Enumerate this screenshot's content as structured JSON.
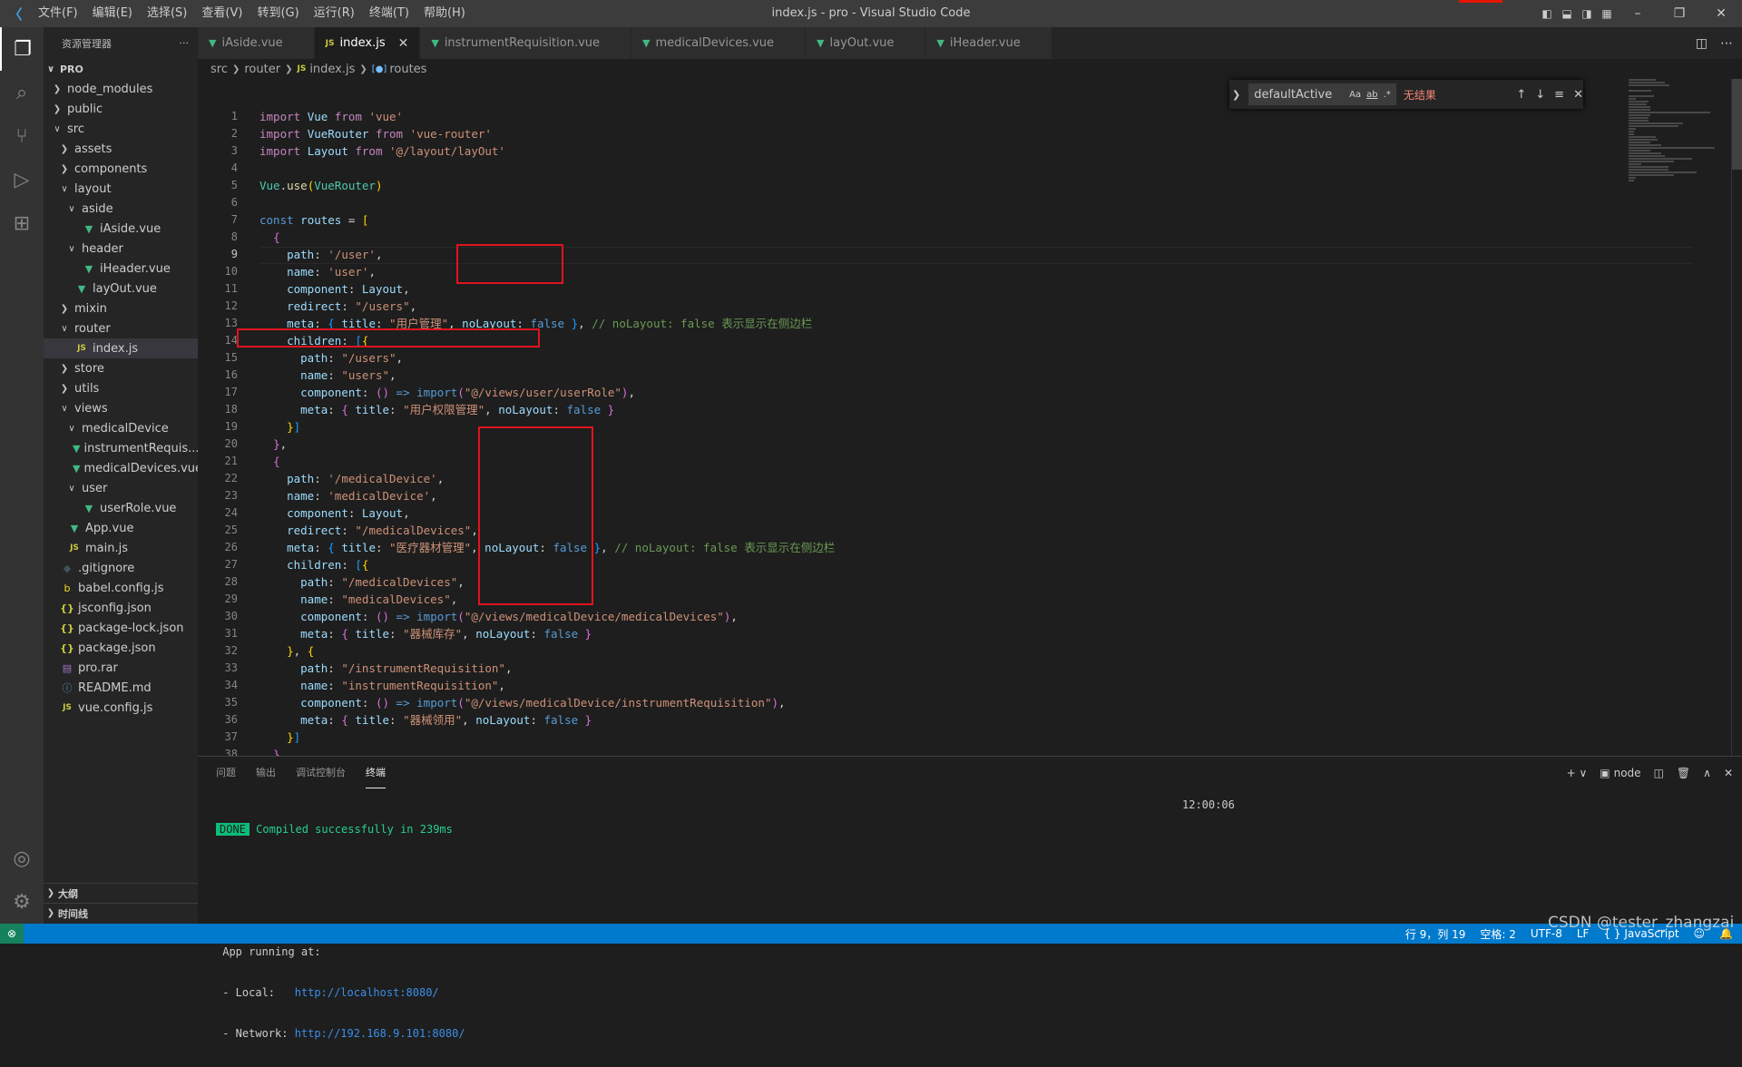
{
  "window": {
    "title": "index.js - pro - Visual Studio Code",
    "menu": [
      "文件(F)",
      "编辑(E)",
      "选择(S)",
      "查看(V)",
      "转到(G)",
      "运行(R)",
      "终端(T)",
      "帮助(H)"
    ]
  },
  "sidebar": {
    "title": "资源管理器",
    "more": "···",
    "root": "PRO",
    "tree": [
      {
        "label": "node_modules",
        "depth": 0,
        "type": "folder",
        "open": false
      },
      {
        "label": "public",
        "depth": 0,
        "type": "folder",
        "open": false
      },
      {
        "label": "src",
        "depth": 0,
        "type": "folder",
        "open": true
      },
      {
        "label": "assets",
        "depth": 1,
        "type": "folder",
        "open": false
      },
      {
        "label": "components",
        "depth": 1,
        "type": "folder",
        "open": false
      },
      {
        "label": "layout",
        "depth": 1,
        "type": "folder",
        "open": true
      },
      {
        "label": "aside",
        "depth": 2,
        "type": "folder",
        "open": true
      },
      {
        "label": "iAside.vue",
        "depth": 3,
        "type": "vue"
      },
      {
        "label": "header",
        "depth": 2,
        "type": "folder",
        "open": true
      },
      {
        "label": "iHeader.vue",
        "depth": 3,
        "type": "vue"
      },
      {
        "label": "layOut.vue",
        "depth": 2,
        "type": "vue"
      },
      {
        "label": "mixin",
        "depth": 1,
        "type": "folder",
        "open": false
      },
      {
        "label": "router",
        "depth": 1,
        "type": "folder",
        "open": true
      },
      {
        "label": "index.js",
        "depth": 2,
        "type": "js",
        "selected": true
      },
      {
        "label": "store",
        "depth": 1,
        "type": "folder",
        "open": false
      },
      {
        "label": "utils",
        "depth": 1,
        "type": "folder",
        "open": false
      },
      {
        "label": "views",
        "depth": 1,
        "type": "folder",
        "open": true
      },
      {
        "label": "medicalDevice",
        "depth": 2,
        "type": "folder",
        "open": true
      },
      {
        "label": "instrumentRequis...",
        "depth": 3,
        "type": "vue"
      },
      {
        "label": "medicalDevices.vue",
        "depth": 3,
        "type": "vue"
      },
      {
        "label": "user",
        "depth": 2,
        "type": "folder",
        "open": true
      },
      {
        "label": "userRole.vue",
        "depth": 3,
        "type": "vue"
      },
      {
        "label": "App.vue",
        "depth": 1,
        "type": "vue"
      },
      {
        "label": "main.js",
        "depth": 1,
        "type": "js"
      },
      {
        "label": ".gitignore",
        "depth": 0,
        "type": "git"
      },
      {
        "label": "babel.config.js",
        "depth": 0,
        "type": "babel"
      },
      {
        "label": "jsconfig.json",
        "depth": 0,
        "type": "json"
      },
      {
        "label": "package-lock.json",
        "depth": 0,
        "type": "json"
      },
      {
        "label": "package.json",
        "depth": 0,
        "type": "json"
      },
      {
        "label": "pro.rar",
        "depth": 0,
        "type": "rar"
      },
      {
        "label": "README.md",
        "depth": 0,
        "type": "info"
      },
      {
        "label": "vue.config.js",
        "depth": 0,
        "type": "js"
      }
    ],
    "outline": "大纲",
    "timeline": "时间线"
  },
  "tabs": [
    {
      "label": "iAside.vue",
      "type": "vue",
      "active": false
    },
    {
      "label": "index.js",
      "type": "js",
      "active": true
    },
    {
      "label": "instrumentRequisition.vue",
      "type": "vue",
      "active": false
    },
    {
      "label": "medicalDevices.vue",
      "type": "vue",
      "active": false
    },
    {
      "label": "layOut.vue",
      "type": "vue",
      "active": false
    },
    {
      "label": "iHeader.vue",
      "type": "vue",
      "active": false
    }
  ],
  "breadcrumb": [
    "src",
    "router",
    "index.js",
    "routes"
  ],
  "find": {
    "value": "defaultActive",
    "options": [
      "Aa",
      "ab",
      ".*"
    ],
    "result": "无结果"
  },
  "editor": {
    "current_line": 9,
    "line_numbers": [
      "1",
      "2",
      "3",
      "4",
      "5",
      "6",
      "7",
      "8",
      "9",
      "10",
      "11",
      "12",
      "13",
      "14",
      "15",
      "16",
      "17",
      "18",
      "19",
      "20",
      "21",
      "22",
      "23",
      "24",
      "25",
      "26",
      "27",
      "28",
      "29",
      "30",
      "31",
      "32",
      "33",
      "34",
      "35",
      "36",
      "37",
      "38"
    ],
    "lines": [
      [
        [
          "kw2",
          "import"
        ],
        [
          "pun",
          " "
        ],
        [
          "var",
          "Vue"
        ],
        [
          "pun",
          " "
        ],
        [
          "kw2",
          "from"
        ],
        [
          "pun",
          " "
        ],
        [
          "str",
          "'vue'"
        ]
      ],
      [
        [
          "kw2",
          "import"
        ],
        [
          "pun",
          " "
        ],
        [
          "var",
          "VueRouter"
        ],
        [
          "pun",
          " "
        ],
        [
          "kw2",
          "from"
        ],
        [
          "pun",
          " "
        ],
        [
          "str",
          "'vue-router'"
        ]
      ],
      [
        [
          "kw2",
          "import"
        ],
        [
          "pun",
          " "
        ],
        [
          "var",
          "Layout"
        ],
        [
          "pun",
          " "
        ],
        [
          "kw2",
          "from"
        ],
        [
          "pun",
          " "
        ],
        [
          "str",
          "'@/layout/layOut'"
        ]
      ],
      [],
      [
        [
          "cls",
          "Vue"
        ],
        [
          "pun",
          "."
        ],
        [
          "fn",
          "use"
        ],
        [
          "br1",
          "("
        ],
        [
          "cls",
          "VueRouter"
        ],
        [
          "br1",
          ")"
        ]
      ],
      [],
      [
        [
          "kw",
          "const"
        ],
        [
          "pun",
          " "
        ],
        [
          "var",
          "routes"
        ],
        [
          "pun",
          " = "
        ],
        [
          "br1",
          "["
        ]
      ],
      [
        [
          "pun",
          "  "
        ],
        [
          "br2",
          "{"
        ]
      ],
      [
        [
          "pun",
          "    "
        ],
        [
          "var",
          "path"
        ],
        [
          "pun",
          ": "
        ],
        [
          "str",
          "'/user'"
        ],
        [
          "pun",
          ","
        ]
      ],
      [
        [
          "pun",
          "    "
        ],
        [
          "var",
          "name"
        ],
        [
          "pun",
          ": "
        ],
        [
          "str",
          "'user'"
        ],
        [
          "pun",
          ","
        ]
      ],
      [
        [
          "pun",
          "    "
        ],
        [
          "var",
          "component"
        ],
        [
          "pun",
          ": "
        ],
        [
          "var",
          "Layout"
        ],
        [
          "pun",
          ","
        ]
      ],
      [
        [
          "pun",
          "    "
        ],
        [
          "var",
          "redirect"
        ],
        [
          "pun",
          ": "
        ],
        [
          "str",
          "\"/users\""
        ],
        [
          "pun",
          ","
        ]
      ],
      [
        [
          "pun",
          "    "
        ],
        [
          "var",
          "meta"
        ],
        [
          "pun",
          ": "
        ],
        [
          "br3",
          "{"
        ],
        [
          "pun",
          " "
        ],
        [
          "var",
          "title"
        ],
        [
          "pun",
          ": "
        ],
        [
          "str",
          "\"用户管理\""
        ],
        [
          "pun",
          ", "
        ],
        [
          "var",
          "noLayout"
        ],
        [
          "pun",
          ": "
        ],
        [
          "kw",
          "false"
        ],
        [
          "pun",
          " "
        ],
        [
          "br3",
          "}"
        ],
        [
          "pun",
          ", "
        ],
        [
          "cmt",
          "// noLayout: false 表示显示在侧边栏"
        ]
      ],
      [
        [
          "pun",
          "    "
        ],
        [
          "var",
          "children"
        ],
        [
          "pun",
          ": "
        ],
        [
          "br3",
          "["
        ],
        [
          "br1",
          "{"
        ]
      ],
      [
        [
          "pun",
          "      "
        ],
        [
          "var",
          "path"
        ],
        [
          "pun",
          ": "
        ],
        [
          "str",
          "\"/users\""
        ],
        [
          "pun",
          ","
        ]
      ],
      [
        [
          "pun",
          "      "
        ],
        [
          "var",
          "name"
        ],
        [
          "pun",
          ": "
        ],
        [
          "str",
          "\"users\""
        ],
        [
          "pun",
          ","
        ]
      ],
      [
        [
          "pun",
          "      "
        ],
        [
          "var",
          "component"
        ],
        [
          "pun",
          ": "
        ],
        [
          "br2",
          "()"
        ],
        [
          "pun",
          " "
        ],
        [
          "kw",
          "=>"
        ],
        [
          "pun",
          " "
        ],
        [
          "kw",
          "import"
        ],
        [
          "br2",
          "("
        ],
        [
          "str",
          "\"@/views/user/userRole\""
        ],
        [
          "br2",
          ")"
        ],
        [
          "pun",
          ","
        ]
      ],
      [
        [
          "pun",
          "      "
        ],
        [
          "var",
          "meta"
        ],
        [
          "pun",
          ": "
        ],
        [
          "br2",
          "{"
        ],
        [
          "pun",
          " "
        ],
        [
          "var",
          "title"
        ],
        [
          "pun",
          ": "
        ],
        [
          "str",
          "\"用户权限管理\""
        ],
        [
          "pun",
          ", "
        ],
        [
          "var",
          "noLayout"
        ],
        [
          "pun",
          ": "
        ],
        [
          "kw",
          "false"
        ],
        [
          "pun",
          " "
        ],
        [
          "br2",
          "}"
        ]
      ],
      [
        [
          "pun",
          "    "
        ],
        [
          "br1",
          "}"
        ],
        [
          "br3",
          "]"
        ]
      ],
      [
        [
          "pun",
          "  "
        ],
        [
          "br2",
          "}"
        ],
        [
          "pun",
          ","
        ]
      ],
      [
        [
          "pun",
          "  "
        ],
        [
          "br2",
          "{"
        ]
      ],
      [
        [
          "pun",
          "    "
        ],
        [
          "var",
          "path"
        ],
        [
          "pun",
          ": "
        ],
        [
          "str",
          "'/medicalDevice'"
        ],
        [
          "pun",
          ","
        ]
      ],
      [
        [
          "pun",
          "    "
        ],
        [
          "var",
          "name"
        ],
        [
          "pun",
          ": "
        ],
        [
          "str",
          "'medicalDevice'"
        ],
        [
          "pun",
          ","
        ]
      ],
      [
        [
          "pun",
          "    "
        ],
        [
          "var",
          "component"
        ],
        [
          "pun",
          ": "
        ],
        [
          "var",
          "Layout"
        ],
        [
          "pun",
          ","
        ]
      ],
      [
        [
          "pun",
          "    "
        ],
        [
          "var",
          "redirect"
        ],
        [
          "pun",
          ": "
        ],
        [
          "str",
          "\"/medicalDevices\""
        ],
        [
          "pun",
          ","
        ]
      ],
      [
        [
          "pun",
          "    "
        ],
        [
          "var",
          "meta"
        ],
        [
          "pun",
          ": "
        ],
        [
          "br3",
          "{"
        ],
        [
          "pun",
          " "
        ],
        [
          "var",
          "title"
        ],
        [
          "pun",
          ": "
        ],
        [
          "str",
          "\"医疗器材管理\""
        ],
        [
          "pun",
          ", "
        ],
        [
          "var",
          "noLayout"
        ],
        [
          "pun",
          ": "
        ],
        [
          "kw",
          "false"
        ],
        [
          "pun",
          " "
        ],
        [
          "br3",
          "}"
        ],
        [
          "pun",
          ", "
        ],
        [
          "cmt",
          "// noLayout: false 表示显示在侧边栏"
        ]
      ],
      [
        [
          "pun",
          "    "
        ],
        [
          "var",
          "children"
        ],
        [
          "pun",
          ": "
        ],
        [
          "br3",
          "["
        ],
        [
          "br1",
          "{"
        ]
      ],
      [
        [
          "pun",
          "      "
        ],
        [
          "var",
          "path"
        ],
        [
          "pun",
          ": "
        ],
        [
          "str",
          "\"/medicalDevices\""
        ],
        [
          "pun",
          ","
        ]
      ],
      [
        [
          "pun",
          "      "
        ],
        [
          "var",
          "name"
        ],
        [
          "pun",
          ": "
        ],
        [
          "str",
          "\"medicalDevices\""
        ],
        [
          "pun",
          ","
        ]
      ],
      [
        [
          "pun",
          "      "
        ],
        [
          "var",
          "component"
        ],
        [
          "pun",
          ": "
        ],
        [
          "br2",
          "()"
        ],
        [
          "pun",
          " "
        ],
        [
          "kw",
          "=>"
        ],
        [
          "pun",
          " "
        ],
        [
          "kw",
          "import"
        ],
        [
          "br2",
          "("
        ],
        [
          "str",
          "\"@/views/medicalDevice/medicalDevices\""
        ],
        [
          "br2",
          ")"
        ],
        [
          "pun",
          ","
        ]
      ],
      [
        [
          "pun",
          "      "
        ],
        [
          "var",
          "meta"
        ],
        [
          "pun",
          ": "
        ],
        [
          "br2",
          "{"
        ],
        [
          "pun",
          " "
        ],
        [
          "var",
          "title"
        ],
        [
          "pun",
          ": "
        ],
        [
          "str",
          "\"器械库存\""
        ],
        [
          "pun",
          ", "
        ],
        [
          "var",
          "noLayout"
        ],
        [
          "pun",
          ": "
        ],
        [
          "kw",
          "false"
        ],
        [
          "pun",
          " "
        ],
        [
          "br2",
          "}"
        ]
      ],
      [
        [
          "pun",
          "    "
        ],
        [
          "br1",
          "}"
        ],
        [
          "pun",
          ", "
        ],
        [
          "br1",
          "{"
        ]
      ],
      [
        [
          "pun",
          "      "
        ],
        [
          "var",
          "path"
        ],
        [
          "pun",
          ": "
        ],
        [
          "str",
          "\"/instrumentRequisition\""
        ],
        [
          "pun",
          ","
        ]
      ],
      [
        [
          "pun",
          "      "
        ],
        [
          "var",
          "name"
        ],
        [
          "pun",
          ": "
        ],
        [
          "str",
          "\"instrumentRequisition\""
        ],
        [
          "pun",
          ","
        ]
      ],
      [
        [
          "pun",
          "      "
        ],
        [
          "var",
          "component"
        ],
        [
          "pun",
          ": "
        ],
        [
          "br2",
          "()"
        ],
        [
          "pun",
          " "
        ],
        [
          "kw",
          "=>"
        ],
        [
          "pun",
          " "
        ],
        [
          "kw",
          "import"
        ],
        [
          "br2",
          "("
        ],
        [
          "str",
          "\"@/views/medicalDevice/instrumentRequisition\""
        ],
        [
          "br2",
          ")"
        ],
        [
          "pun",
          ","
        ]
      ],
      [
        [
          "pun",
          "      "
        ],
        [
          "var",
          "meta"
        ],
        [
          "pun",
          ": "
        ],
        [
          "br2",
          "{"
        ],
        [
          "pun",
          " "
        ],
        [
          "var",
          "title"
        ],
        [
          "pun",
          ": "
        ],
        [
          "str",
          "\"器械领用\""
        ],
        [
          "pun",
          ", "
        ],
        [
          "var",
          "noLayout"
        ],
        [
          "pun",
          ": "
        ],
        [
          "kw",
          "false"
        ],
        [
          "pun",
          " "
        ],
        [
          "br2",
          "}"
        ]
      ],
      [
        [
          "pun",
          "    "
        ],
        [
          "br1",
          "}"
        ],
        [
          "br3",
          "]"
        ]
      ],
      [
        [
          "pun",
          "  "
        ],
        [
          "br2",
          "}"
        ]
      ]
    ]
  },
  "panel": {
    "tabs": [
      "问题",
      "输出",
      "调试控制台",
      "终端"
    ],
    "active_tab": "终端",
    "terminal_name": "node",
    "terminal": {
      "done": "DONE",
      "compiled": "Compiled successfully in 239ms",
      "time": "12:00:06",
      "running": "App running at:",
      "local_label": "- Local:   ",
      "local_url": "http://localhost:8080/",
      "network_label": "- Network: ",
      "network_url": "http://192.168.9.101:8080/"
    }
  },
  "statusbar": {
    "position": "行 9，列 19",
    "spaces": "空格: 2",
    "encoding": "UTF-8",
    "eol": "LF",
    "language": "{ } JavaScript"
  },
  "watermark": "CSDN @tester_zhangzai"
}
